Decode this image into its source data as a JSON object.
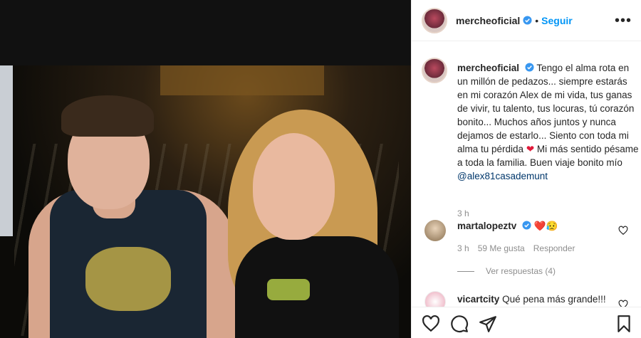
{
  "post": {
    "username": "mercheoficial",
    "follow_label": "Seguir",
    "dot": "•",
    "more_label": "•••"
  },
  "caption": {
    "username": "mercheoficial",
    "text": "Tengo el alma rota en un millón de pedazos... siempre estarás en mi corazón Alex de mi vida, tus ganas de vivir, tu talento, tus locuras, tú corazón bonito... Muchos años juntos y nunca dejamos de estarlo... Siento con toda mi alma tu pérdida",
    "heart": "❤",
    "text2": "Mi más sentido pésame a toda la familia. Buen viaje bonito mío",
    "mention": "@alex81casademunt",
    "time": "3 h"
  },
  "comments": [
    {
      "username": "martalopeztv",
      "emoji": "❤️😥",
      "time": "3 h",
      "likes": "59 Me gusta",
      "reply_label": "Responder",
      "view_replies": "Ver respuestas (4)"
    },
    {
      "username": "vicartcity",
      "text": "Qué pena más grande!!!"
    }
  ],
  "colors": {
    "accent": "#0095f6",
    "verified": "#3897f0",
    "heart": "#e01a3a",
    "muted": "#8e8e8e"
  },
  "icons": {
    "like": "heart-outline-icon",
    "comment": "comment-icon",
    "share": "paper-plane-icon",
    "save": "bookmark-icon"
  }
}
